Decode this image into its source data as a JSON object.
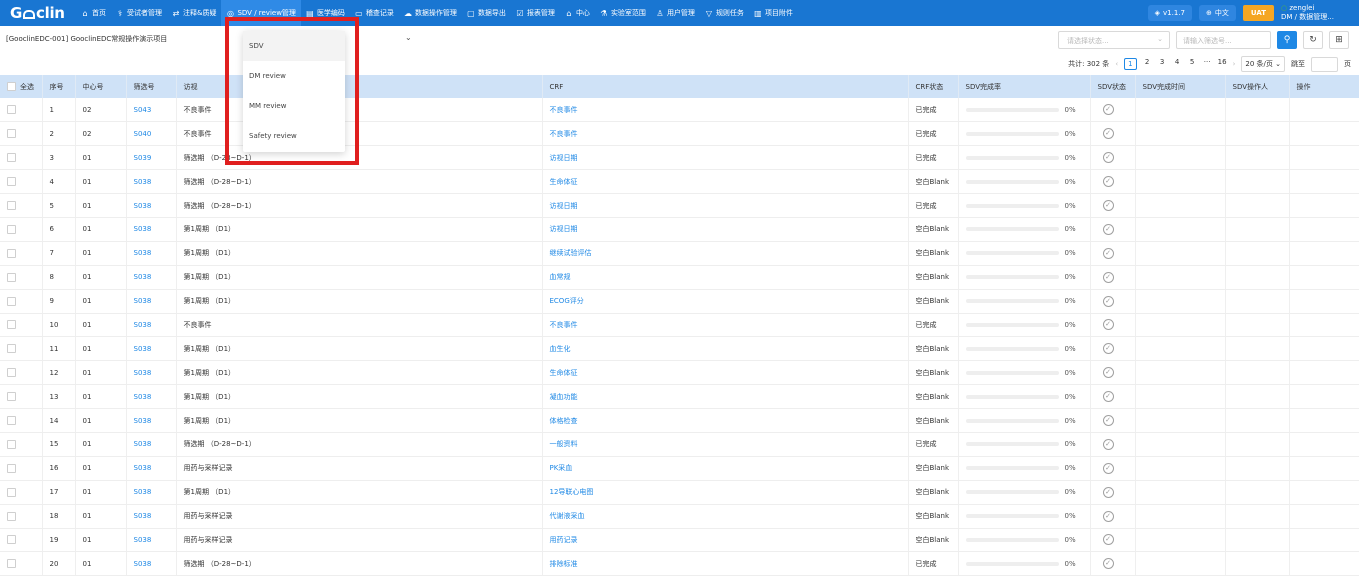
{
  "app": {
    "logo_text": "Gooclin"
  },
  "nav": [
    {
      "icon": "home-icon",
      "glyph": "⌂",
      "label": "首页"
    },
    {
      "icon": "subject-icon",
      "glyph": "⚕",
      "label": "受试者管理"
    },
    {
      "icon": "query-icon",
      "glyph": "⇄",
      "label": "注释&质疑"
    },
    {
      "icon": "sdv-icon",
      "glyph": "◎",
      "label": "SDV / review管理"
    },
    {
      "icon": "medical-coding-icon",
      "glyph": "▤",
      "label": "医学编码"
    },
    {
      "icon": "audit-icon",
      "glyph": "▭",
      "label": "稽查记录"
    },
    {
      "icon": "data-ops-icon",
      "glyph": "☁",
      "label": "数据操作管理"
    },
    {
      "icon": "export-icon",
      "glyph": "▢",
      "label": "数据导出"
    },
    {
      "icon": "report-icon",
      "glyph": "☑",
      "label": "报表管理"
    },
    {
      "icon": "center-icon",
      "glyph": "⌂",
      "label": "中心"
    },
    {
      "icon": "lab-range-icon",
      "glyph": "⚗",
      "label": "实验室范围"
    },
    {
      "icon": "user-icon",
      "glyph": "♙",
      "label": "用户管理"
    },
    {
      "icon": "task-icon",
      "glyph": "▽",
      "label": "规则任务"
    },
    {
      "icon": "attachment-icon",
      "glyph": "▥",
      "label": "项目附件"
    }
  ],
  "header": {
    "version": "v1.1.7",
    "language": "中文",
    "env_badge": "UAT",
    "username": "zenglei",
    "role": "DM / 数据管理..."
  },
  "filter": {
    "project": "[GooclinEDC-001]  GooclinEDC常规操作演示项目",
    "status_placeholder": "请选择状态...",
    "subject_placeholder": "请输入筛选号..."
  },
  "dropdown": {
    "options": [
      "SDV",
      "DM review",
      "MM review",
      "Safety review"
    ],
    "selected": "SDV"
  },
  "pagination": {
    "total_label": "共计:",
    "total": "302 条",
    "pages": [
      "1",
      "2",
      "3",
      "4",
      "5",
      "···",
      "16"
    ],
    "current": "1",
    "page_size": "20 条/页",
    "jump_label": "跳至",
    "page_suffix": "页"
  },
  "table": {
    "headers": [
      "全选",
      "序号",
      "中心号",
      "筛选号",
      "访视",
      "CRF",
      "CRF状态",
      "SDV完成率",
      "SDV状态",
      "SDV完成时间",
      "SDV操作人",
      "操作"
    ],
    "rows": [
      [
        "1",
        "02",
        "S043",
        "不良事件",
        "不良事件",
        "已完成",
        "0%"
      ],
      [
        "2",
        "02",
        "S040",
        "不良事件",
        "不良事件",
        "已完成",
        "0%"
      ],
      [
        "3",
        "01",
        "S039",
        "筛选期 （D-28~D-1）",
        "访视日期",
        "已完成",
        "0%"
      ],
      [
        "4",
        "01",
        "S038",
        "筛选期 （D-28~D-1）",
        "生命体征",
        "空白Blank",
        "0%"
      ],
      [
        "5",
        "01",
        "S038",
        "筛选期 （D-28~D-1）",
        "访视日期",
        "已完成",
        "0%"
      ],
      [
        "6",
        "01",
        "S038",
        "第1周期 （D1）",
        "访视日期",
        "空白Blank",
        "0%"
      ],
      [
        "7",
        "01",
        "S038",
        "第1周期 （D1）",
        "继续试验评估",
        "空白Blank",
        "0%"
      ],
      [
        "8",
        "01",
        "S038",
        "第1周期 （D1）",
        "血常规",
        "空白Blank",
        "0%"
      ],
      [
        "9",
        "01",
        "S038",
        "第1周期 （D1）",
        "ECOG评分",
        "空白Blank",
        "0%"
      ],
      [
        "10",
        "01",
        "S038",
        "不良事件",
        "不良事件",
        "已完成",
        "0%"
      ],
      [
        "11",
        "01",
        "S038",
        "第1周期 （D1）",
        "血生化",
        "空白Blank",
        "0%"
      ],
      [
        "12",
        "01",
        "S038",
        "第1周期 （D1）",
        "生命体征",
        "空白Blank",
        "0%"
      ],
      [
        "13",
        "01",
        "S038",
        "第1周期 （D1）",
        "凝血功能",
        "空白Blank",
        "0%"
      ],
      [
        "14",
        "01",
        "S038",
        "第1周期 （D1）",
        "体格检查",
        "空白Blank",
        "0%"
      ],
      [
        "15",
        "01",
        "S038",
        "筛选期 （D-28~D-1）",
        "一般资料",
        "已完成",
        "0%"
      ],
      [
        "16",
        "01",
        "S038",
        "用药与采样记录",
        "PK采血",
        "空白Blank",
        "0%"
      ],
      [
        "17",
        "01",
        "S038",
        "第1周期 （D1）",
        "12导联心电图",
        "空白Blank",
        "0%"
      ],
      [
        "18",
        "01",
        "S038",
        "用药与采样记录",
        "代谢液采血",
        "空白Blank",
        "0%"
      ],
      [
        "19",
        "01",
        "S038",
        "用药与采样记录",
        "用药记录",
        "空白Blank",
        "0%"
      ],
      [
        "20",
        "01",
        "S038",
        "筛选期 （D-28~D-1）",
        "排除标准",
        "已完成",
        "0%"
      ]
    ]
  },
  "colors": {
    "nav_bg": "#1976d2",
    "accent": "#1e88e5",
    "uat": "#f5a623",
    "highlight": "#e01f1f",
    "header_bg": "#cfe2f7"
  }
}
